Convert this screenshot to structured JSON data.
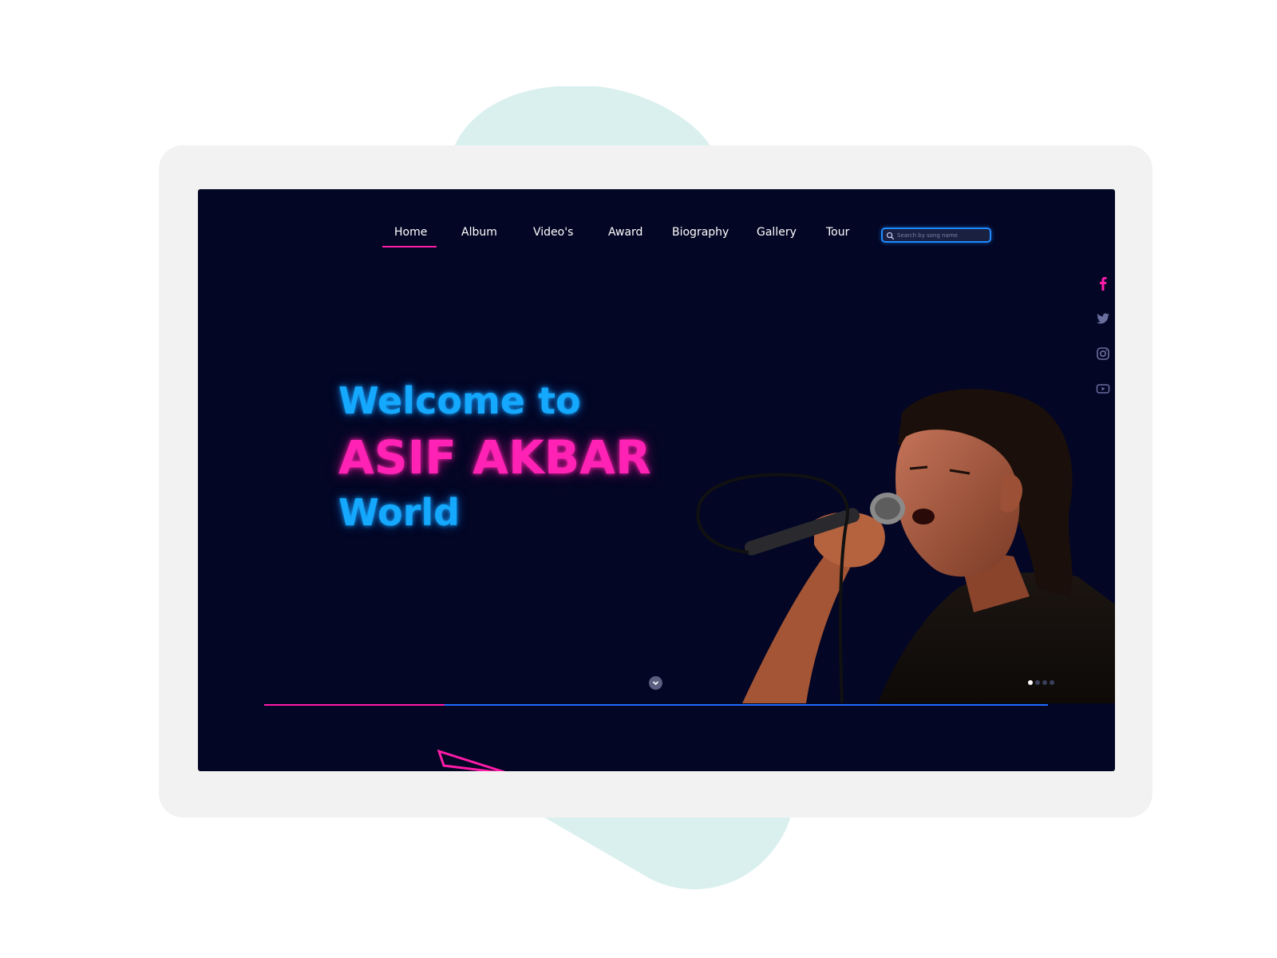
{
  "nav": {
    "items": [
      {
        "label": "Home",
        "active": true
      },
      {
        "label": "Album",
        "active": false
      },
      {
        "label": "Video's",
        "active": false
      },
      {
        "label": "Award",
        "active": false
      },
      {
        "label": "Biography",
        "active": false
      },
      {
        "label": "Gallery",
        "active": false
      },
      {
        "label": "Tour",
        "active": false
      }
    ]
  },
  "search": {
    "placeholder": "Search by song name",
    "value": ""
  },
  "hero": {
    "line1": "Welcome to",
    "line2": "ASIF AKBAR",
    "line3": "World"
  },
  "social": [
    "facebook-icon",
    "twitter-icon",
    "instagram-icon",
    "youtube-icon"
  ],
  "slider": {
    "total": 4,
    "active": 1
  },
  "progress": {
    "fraction": 0.23
  },
  "colors": {
    "background": "#030624",
    "accent_pink": "#ff1ca8",
    "accent_blue": "#14a8ff",
    "blob": "#daf0ee"
  }
}
